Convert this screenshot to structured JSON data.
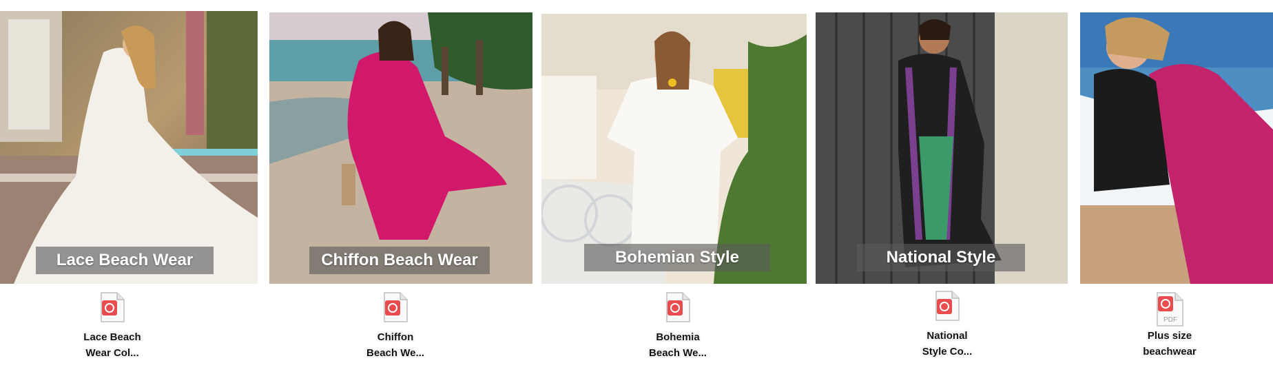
{
  "categories": [
    {
      "caption": "Lace Beach Wear",
      "file_line1": "Lace Beach",
      "file_line2": "Wear Col...",
      "icon": "pdf-file-icon"
    },
    {
      "caption": "Chiffon Beach Wear",
      "file_line1": "Chiffon",
      "file_line2": "Beach We...",
      "icon": "pdf-file-icon"
    },
    {
      "caption": "Bohemian Style",
      "file_line1": "Bohemia",
      "file_line2": "Beach We...",
      "icon": "pdf-file-icon"
    },
    {
      "caption": "National Style",
      "file_line1": "National",
      "file_line2": "Style Co...",
      "icon": "pdf-file-icon"
    },
    {
      "caption": "",
      "file_line1": "Plus size",
      "file_line2": "beachwear",
      "icon": "pdf-file-icon",
      "icon_badge": "PDF"
    }
  ],
  "colors": {
    "caption_overlay": "#5a5a5a",
    "pdf_badge": "#e84c4f"
  }
}
